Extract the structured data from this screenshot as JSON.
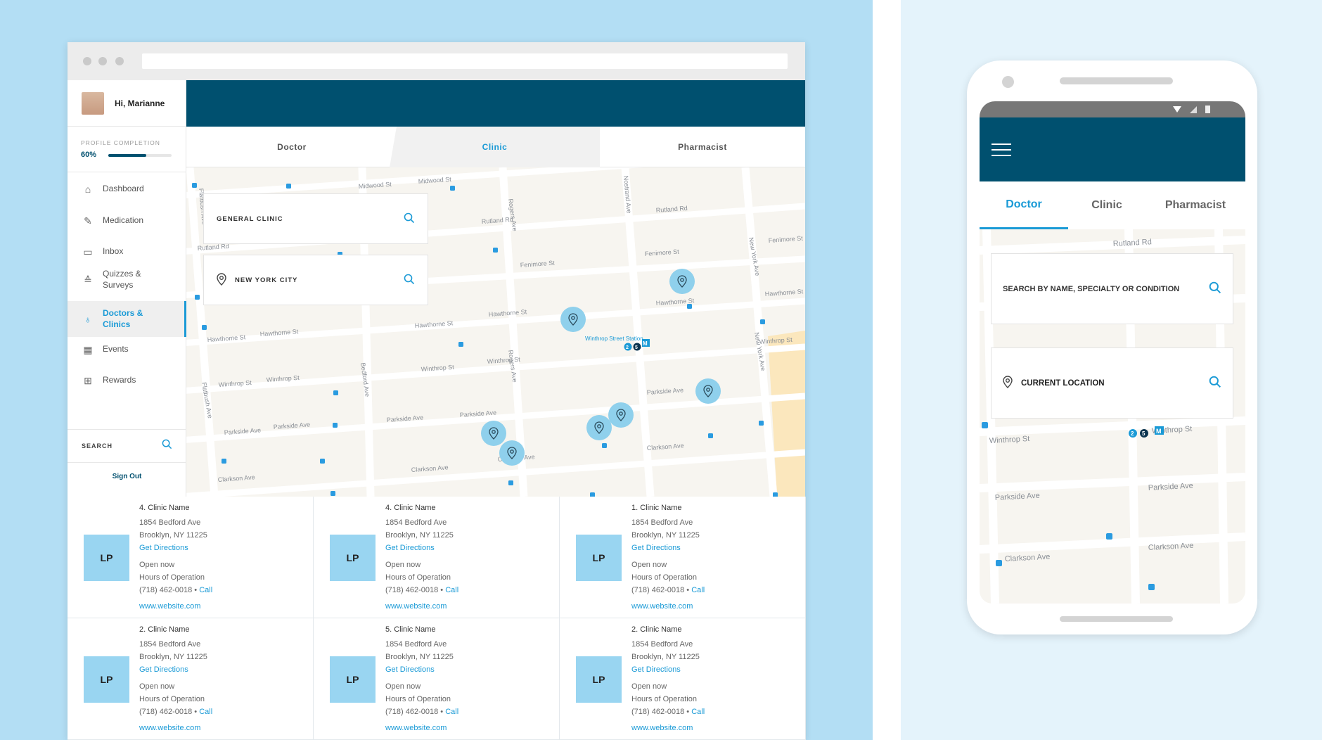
{
  "browser": {
    "user": {
      "greeting": "Hi, Marianne"
    },
    "profile": {
      "label": "PROFILE COMPLETION",
      "percent_label": "60%",
      "percent": 60
    },
    "nav": [
      {
        "label": "Dashboard",
        "icon": "home-icon"
      },
      {
        "label": "Medication",
        "icon": "pill-icon"
      },
      {
        "label": "Inbox",
        "icon": "inbox-icon"
      },
      {
        "label": "Quizzes & Surveys",
        "icon": "graduation-cap-icon"
      },
      {
        "label": "Doctors & Clinics",
        "icon": "stethoscope-icon",
        "active": true
      },
      {
        "label": "Events",
        "icon": "calendar-icon"
      },
      {
        "label": "Rewards",
        "icon": "gift-icon"
      }
    ],
    "sidebar_search": "SEARCH",
    "sign_out": "Sign Out",
    "tabs": [
      "Doctor",
      "Clinic",
      "Pharmacist"
    ],
    "active_tab": "Clinic",
    "search": {
      "query": "GENERAL CLINIC",
      "location": "NEW YORK CITY"
    },
    "map": {
      "streets": [
        "Midwood St",
        "Midwood St",
        "Rutland Rd",
        "Rutland Rd",
        "Rutland Rd",
        "Fenimore St",
        "Fenimore St",
        "Fenimore St",
        "Hawthorne St",
        "Hawthorne St",
        "Hawthorne St",
        "Hawthorne St",
        "Hawthorne St",
        "Hawthorne St",
        "Winthrop St",
        "Winthrop St",
        "Winthrop St",
        "Winthrop St",
        "Winthrop St",
        "Parkside Ave",
        "Parkside Ave",
        "Parkside Ave",
        "Parkside Ave",
        "Parkside Ave",
        "Clarkson Ave",
        "Clarkson Ave",
        "Clarkson Ave",
        "Clarkson Ave",
        "Flatbush Ave",
        "Flatbush Ave",
        "Bedford Ave",
        "Rogers Ave",
        "Rogers Ave",
        "Nostrand Ave",
        "New York Ave",
        "New York Ave"
      ],
      "station": "Winthrop Street Station",
      "subway_lines": [
        "2",
        "5"
      ],
      "metro_badge": "M",
      "pin_count": 7
    },
    "results": [
      {
        "name": "4. Clinic Name",
        "initials": "LP",
        "address": "1854 Bedford Ave",
        "city": "Brooklyn, NY  11225",
        "directions": "Get Directions",
        "status": "Open now",
        "hours": "Hours of Operation",
        "phone": "(718) 462-0018 •",
        "call": "Call",
        "website": "www.website.com"
      },
      {
        "name": "4. Clinic Name",
        "initials": "LP",
        "address": "1854 Bedford Ave",
        "city": "Brooklyn, NY  11225",
        "directions": "Get Directions",
        "status": "Open now",
        "hours": "Hours of Operation",
        "phone": "(718) 462-0018 •",
        "call": "Call",
        "website": "www.website.com"
      },
      {
        "name": "1. Clinic Name",
        "initials": "LP",
        "address": "1854 Bedford Ave",
        "city": "Brooklyn, NY  11225",
        "directions": "Get Directions",
        "status": "Open now",
        "hours": "Hours of Operation",
        "phone": "(718) 462-0018 •",
        "call": "Call",
        "website": "www.website.com"
      },
      {
        "name": "2. Clinic Name",
        "initials": "LP",
        "address": "1854 Bedford Ave",
        "city": "Brooklyn, NY  11225",
        "directions": "Get Directions",
        "status": "Open now",
        "hours": "Hours of Operation",
        "phone": "(718) 462-0018 •",
        "call": "Call",
        "website": "www.website.com"
      },
      {
        "name": "5. Clinic Name",
        "initials": "LP",
        "address": "1854 Bedford Ave",
        "city": "Brooklyn, NY  11225",
        "directions": "Get Directions",
        "status": "Open now",
        "hours": "Hours of Operation",
        "phone": "(718) 462-0018 •",
        "call": "Call",
        "website": "www.website.com"
      },
      {
        "name": "2. Clinic Name",
        "initials": "LP",
        "address": "1854 Bedford Ave",
        "city": "Brooklyn, NY  11225",
        "directions": "Get Directions",
        "status": "Open now",
        "hours": "Hours of Operation",
        "phone": "(718) 462-0018 •",
        "call": "Call",
        "website": "www.website.com"
      }
    ]
  },
  "phone": {
    "tabs": [
      "Doctor",
      "Clinic",
      "Pharmacist"
    ],
    "active_tab": "Doctor",
    "search_placeholder": "SEARCH BY NAME, SPECIALTY OR CONDITION",
    "location": "CURRENT LOCATION",
    "map": {
      "streets": [
        "Rutland Rd",
        "Winthrop St",
        "Winthrop St",
        "Parkside Ave",
        "Parkside Ave",
        "Clarkson Ave",
        "Clarkson Ave"
      ],
      "subway_lines": [
        "2",
        "5"
      ],
      "metro_badge": "M"
    }
  },
  "colors": {
    "brand_dark": "#00506f",
    "accent": "#1a9ad6",
    "pin": "#8fd0ec",
    "logo_tile": "#99d5f1",
    "background": "#b3def4"
  }
}
